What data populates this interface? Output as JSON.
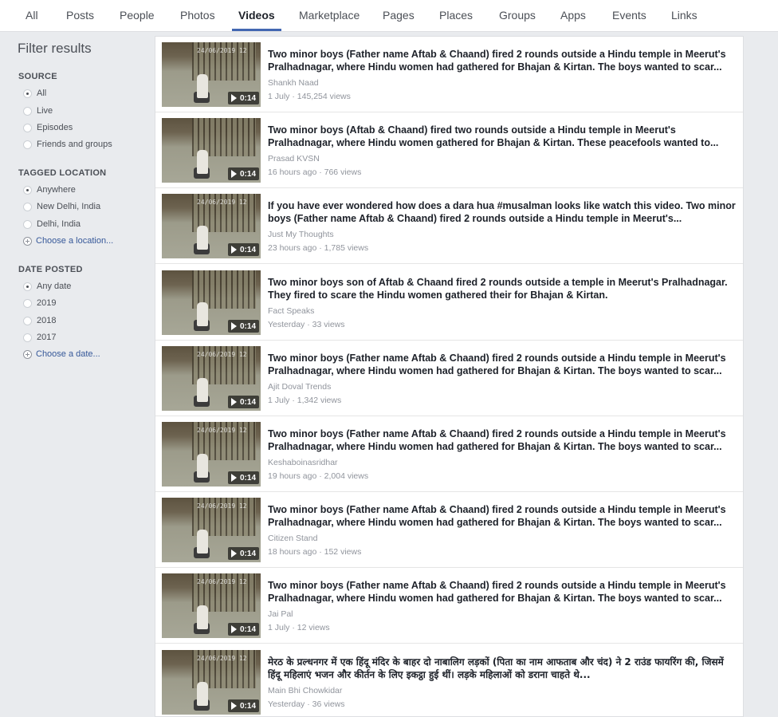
{
  "tabs": [
    "All",
    "Posts",
    "People",
    "Photos",
    "Videos",
    "Marketplace",
    "Pages",
    "Places",
    "Groups",
    "Apps",
    "Events",
    "Links"
  ],
  "active_tab": "Videos",
  "sidebar": {
    "title": "Filter results",
    "source": {
      "heading": "SOURCE",
      "options": [
        "All",
        "Live",
        "Episodes",
        "Friends and groups"
      ],
      "selected": "All"
    },
    "location": {
      "heading": "TAGGED LOCATION",
      "options": [
        "Anywhere",
        "New Delhi, India",
        "Delhi, India"
      ],
      "selected": "Anywhere",
      "choose": "Choose a location..."
    },
    "date": {
      "heading": "DATE POSTED",
      "options": [
        "Any date",
        "2019",
        "2018",
        "2017"
      ],
      "selected": "Any date",
      "choose": "Choose a date..."
    }
  },
  "results": [
    {
      "title": "Two minor boys (Father name Aftab & Chaand) fired 2 rounds outside a Hindu temple in Meerut's Pralhadnagar, where Hindu women had gathered for Bhajan & Kirtan. The boys wanted to scar...",
      "author": "Shankh Naad",
      "meta": "1 July · 145,254 views",
      "duration": "0:14",
      "stamp": "24/06/2019 12"
    },
    {
      "title": "Two minor boys (Aftab & Chaand) fired two rounds outside a Hindu temple in Meerut's Pralhadnagar, where Hindu women gathered for Bhajan & Kirtan. These peacefools wanted to...",
      "author": "Prasad KVSN",
      "meta": "16 hours ago · 766 views",
      "duration": "0:14",
      "stamp": ""
    },
    {
      "title": "If you have ever wondered how does a dara hua #musalman looks like watch this video. Two minor boys (Father name Aftab & Chaand) fired 2 rounds outside a Hindu temple in Meerut's...",
      "author": "Just My Thoughts",
      "meta": "23 hours ago · 1,785 views",
      "duration": "0:14",
      "stamp": "24/06/2019 12"
    },
    {
      "title": "Two minor boys son of Aftab & Chaand fired 2 rounds outside a temple in Meerut's Pralhadnagar. They fired to scare the Hindu women gathered their for Bhajan & Kirtan.",
      "author": "Fact Speaks",
      "meta": "Yesterday · 33 views",
      "duration": "0:14",
      "stamp": ""
    },
    {
      "title": "Two minor boys (Father name Aftab & Chaand) fired 2 rounds outside a Hindu temple in Meerut's Pralhadnagar, where Hindu women had gathered for Bhajan & Kirtan. The boys wanted to scar...",
      "author": "Ajit Doval Trends",
      "meta": "1 July · 1,342 views",
      "duration": "0:14",
      "stamp": "24/06/2019 12"
    },
    {
      "title": "Two minor boys (Father name Aftab & Chaand) fired 2 rounds outside a Hindu temple in Meerut's Pralhadnagar, where Hindu women had gathered for Bhajan & Kirtan. The boys wanted to scar...",
      "author": "Keshaboinasridhar",
      "meta": "19 hours ago · 2,004 views",
      "duration": "0:14",
      "stamp": "24/06/2019 12"
    },
    {
      "title": "Two minor boys (Father name Aftab & Chaand) fired 2 rounds outside a Hindu temple in Meerut's Pralhadnagar, where Hindu women had gathered for Bhajan & Kirtan. The boys wanted to scar...",
      "author": "Citizen Stand",
      "meta": "18 hours ago · 152 views",
      "duration": "0:14",
      "stamp": "24/06/2019 12"
    },
    {
      "title": "Two minor boys (Father name Aftab & Chaand) fired 2 rounds outside a Hindu temple in Meerut's Pralhadnagar, where Hindu women had gathered for Bhajan & Kirtan. The boys wanted to scar...",
      "author": "Jai Pal",
      "meta": "1 July · 12 views",
      "duration": "0:14",
      "stamp": "24/06/2019 12"
    },
    {
      "title": "मेरठ के प्रल्धनगर में एक हिंदू मंदिर के बाहर दो नाबालिग लड़कों (पिता का नाम आफताब और चंद) ने 2 राउंड फायरिंग की, जिसमें हिंदू महिलाएं भजन और कीर्तन के लिए इकट्ठा हुई थीं। लड़के महिलाओं को डराना चाहते थे...",
      "author": "Main Bhi Chowkidar",
      "meta": "Yesterday · 36 views",
      "duration": "0:14",
      "stamp": "24/06/2019 12"
    }
  ]
}
